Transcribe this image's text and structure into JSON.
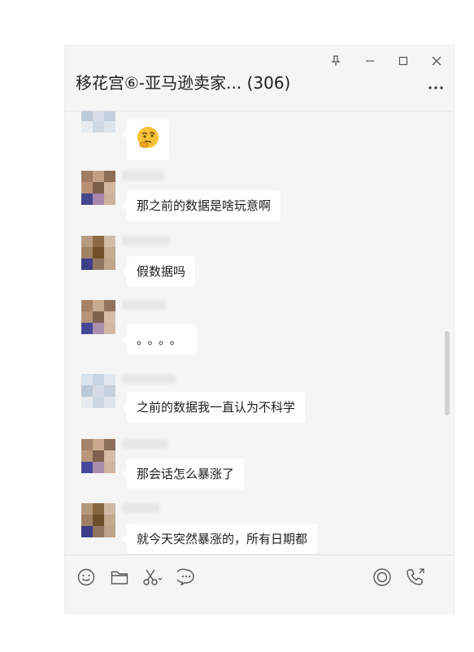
{
  "window": {
    "title": "移花宫⑥-亚马逊卖家... (306)",
    "controls": [
      "pin-icon",
      "minimize-icon",
      "maximize-icon",
      "close-icon"
    ],
    "more_icon": "more-icon"
  },
  "messages": [
    {
      "type": "emoji",
      "emoji": "thinking-face"
    },
    {
      "type": "text",
      "text": "那之前的数据是啥玩意啊"
    },
    {
      "type": "text",
      "text": "假数据吗"
    },
    {
      "type": "text",
      "text": "。。。。"
    },
    {
      "type": "text",
      "text": "之前的数据我一直认为不科学"
    },
    {
      "type": "text",
      "text": "那会话怎么暴涨了"
    },
    {
      "type": "text",
      "text": "就今天突然暴涨的，所有日期都"
    }
  ],
  "toolbar": {
    "left": [
      "emoji-icon",
      "folder-icon",
      "scissors-icon",
      "chat-history-icon"
    ],
    "right": [
      "live-icon",
      "call-icon"
    ]
  },
  "colors": {
    "bubble": "#ffffff",
    "background": "#f5f5f5",
    "text": "#1e1e1e",
    "icon": "#555555"
  }
}
